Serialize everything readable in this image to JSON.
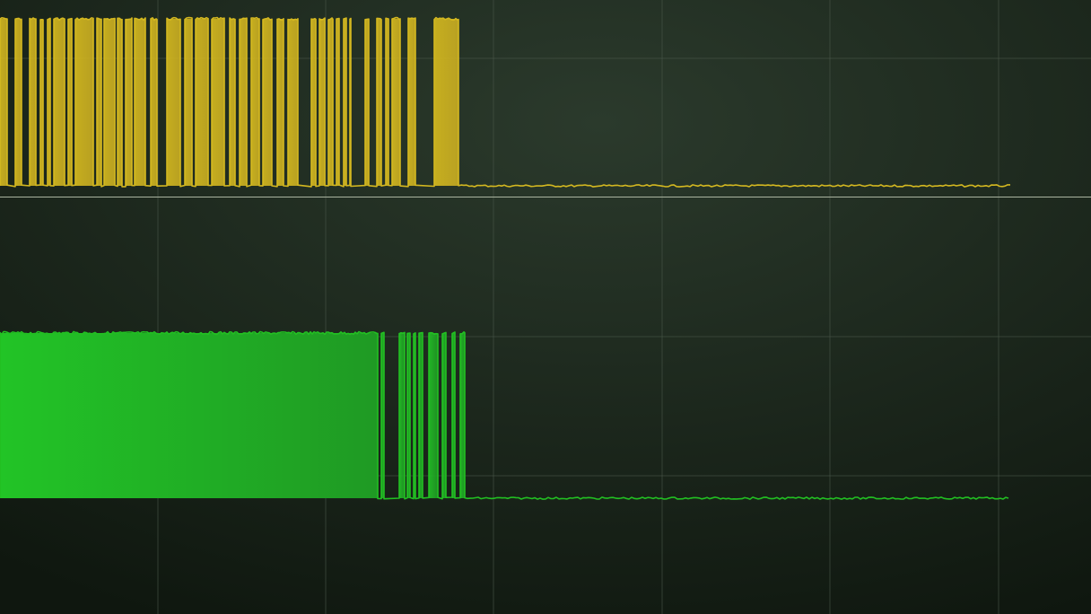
{
  "screen": {
    "background_center": "#2b3a2c",
    "background_edge": "#0f170f",
    "grid_color": "#4a564a",
    "divider_color": "#aab4a0"
  },
  "chart_data": {
    "type": "line",
    "title": "",
    "xlabel": "",
    "ylabel": "",
    "grid": true,
    "legend": "none",
    "x_range": [
      0,
      1216
    ],
    "series": [
      {
        "color": "#d4b820",
        "channel": 1,
        "high_level": 1,
        "low_level": 0,
        "burst_start": 0,
        "burst_end": 511,
        "trace_end": 1126,
        "pulses": [
          [
            0,
            8
          ],
          [
            17,
            24
          ],
          [
            33,
            40
          ],
          [
            45,
            48
          ],
          [
            53,
            56
          ],
          [
            60,
            72
          ],
          [
            76,
            80
          ],
          [
            84,
            104
          ],
          [
            108,
            113
          ],
          [
            116,
            128
          ],
          [
            131,
            136
          ],
          [
            140,
            147
          ],
          [
            150,
            162
          ],
          [
            168,
            175
          ],
          [
            186,
            201
          ],
          [
            206,
            214
          ],
          [
            218,
            232
          ],
          [
            236,
            250
          ],
          [
            256,
            262
          ],
          [
            267,
            275
          ],
          [
            280,
            289
          ],
          [
            293,
            303
          ],
          [
            309,
            316
          ],
          [
            321,
            332
          ],
          [
            347,
            352
          ],
          [
            356,
            362
          ],
          [
            366,
            371
          ],
          [
            375,
            378
          ],
          [
            383,
            386
          ],
          [
            390,
            391
          ],
          [
            407,
            411
          ],
          [
            420,
            425
          ],
          [
            430,
            433
          ],
          [
            437,
            446
          ],
          [
            455,
            463
          ],
          [
            484,
            511
          ]
        ]
      },
      {
        "color": "#22c022",
        "channel": 2,
        "high_level": 1,
        "low_level": 0,
        "dense_end": 421,
        "burst_end": 518,
        "trace_end": 1126,
        "pulses": [
          [
            0,
            421
          ],
          [
            425,
            428
          ],
          [
            445,
            451
          ],
          [
            454,
            457
          ],
          [
            461,
            463
          ],
          [
            467,
            471
          ],
          [
            478,
            488
          ],
          [
            493,
            497
          ],
          [
            504,
            507
          ],
          [
            513,
            518
          ]
        ]
      }
    ]
  }
}
